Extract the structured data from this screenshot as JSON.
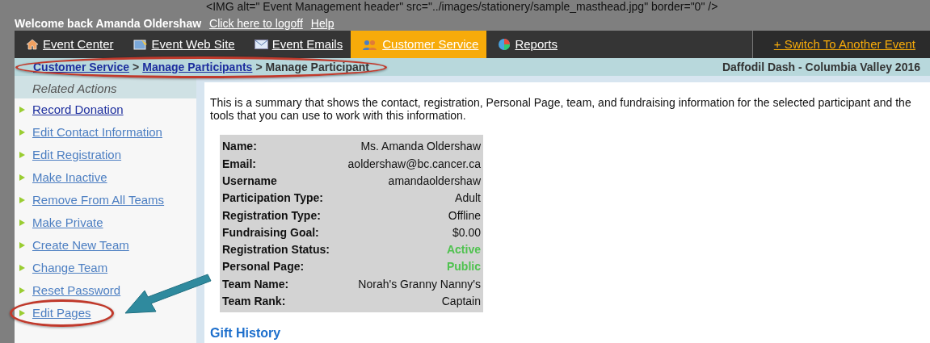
{
  "masthead_alt_text": "<IMG alt=\" Event Management header\" src=\"../images/stationery/sample_masthead.jpg\" border=\"0\" />",
  "welcome": {
    "text": "Welcome back Amanda Oldershaw",
    "links": [
      "Click here to logoff",
      "Help"
    ]
  },
  "nav": {
    "tabs": [
      {
        "label": "Event Center",
        "selected": false
      },
      {
        "label": "Event Web Site",
        "selected": false
      },
      {
        "label": "Event Emails",
        "selected": false
      },
      {
        "label": "Customer Service",
        "selected": true
      },
      {
        "label": "Reports",
        "selected": false
      }
    ],
    "switch_link": "+ Switch To Another Event"
  },
  "breadcrumb": {
    "circled": true,
    "links": [
      "Customer Service",
      "Manage Participants"
    ],
    "current": "Manage Participant",
    "separator": ">"
  },
  "event_name": "Daffodil Dash - Columbia Valley 2016",
  "sidebar": {
    "heading": "Related Actions",
    "items": [
      {
        "label": "Record Donation",
        "visited": true,
        "circled": false,
        "pointed": false
      },
      {
        "label": "Edit Contact Information",
        "visited": false,
        "circled": false,
        "pointed": false
      },
      {
        "label": "Edit Registration",
        "visited": false,
        "circled": false,
        "pointed": false
      },
      {
        "label": "Make Inactive",
        "visited": false,
        "circled": false,
        "pointed": false
      },
      {
        "label": "Remove From All Teams",
        "visited": false,
        "circled": false,
        "pointed": false
      },
      {
        "label": "Make Private",
        "visited": false,
        "circled": false,
        "pointed": false
      },
      {
        "label": "Create New Team",
        "visited": false,
        "circled": false,
        "pointed": false
      },
      {
        "label": "Change Team",
        "visited": false,
        "circled": false,
        "pointed": false
      },
      {
        "label": "Reset Password",
        "visited": false,
        "circled": false,
        "pointed": false
      },
      {
        "label": "Edit Pages",
        "visited": false,
        "circled": true,
        "pointed": true
      }
    ]
  },
  "intro": "This is a summary that shows the contact, registration, Personal Page, team, and fundraising information for the selected participant and the tools that you can use to work with this information.",
  "summary": [
    {
      "label": "Name:",
      "value": "Ms. Amanda Oldershaw",
      "kind": "plain"
    },
    {
      "label": "Email:",
      "value": "aoldershaw@bc.cancer.ca",
      "kind": "plain"
    },
    {
      "label": "Username",
      "value": "amandaoldershaw",
      "kind": "plain"
    },
    {
      "label": "Participation Type:",
      "value": "Adult",
      "kind": "plain"
    },
    {
      "label": "Registration Type:",
      "value": "Offline",
      "kind": "plain"
    },
    {
      "label": "Fundraising Goal:",
      "value": "$0.00",
      "kind": "plain"
    },
    {
      "label": "Registration Status:",
      "value": "Active",
      "kind": "status"
    },
    {
      "label": "Personal Page:",
      "value": "Public",
      "kind": "status"
    },
    {
      "label": "Team Name:",
      "value": "Norah's Granny Nanny's",
      "kind": "plain"
    },
    {
      "label": "Team Rank:",
      "value": "Captain",
      "kind": "plain"
    }
  ],
  "section_heading": "Gift History"
}
